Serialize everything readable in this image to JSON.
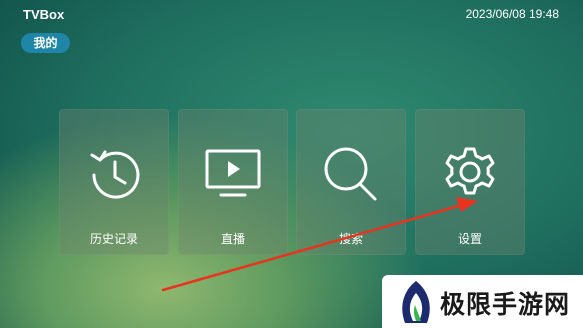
{
  "header": {
    "title": "TVBox",
    "datetime": "2023/06/08 19:48"
  },
  "badge": {
    "label": "我的"
  },
  "tiles": [
    {
      "label": "历史记录",
      "icon": "history-clock-icon"
    },
    {
      "label": "直播",
      "icon": "tv-play-icon"
    },
    {
      "label": "搜索",
      "icon": "search-icon"
    },
    {
      "label": "设置",
      "icon": "gear-icon"
    }
  ],
  "annotation": {
    "arrow_color": "#e8331f",
    "points_to": "设置"
  },
  "watermark": {
    "text": "极限手游网"
  }
}
